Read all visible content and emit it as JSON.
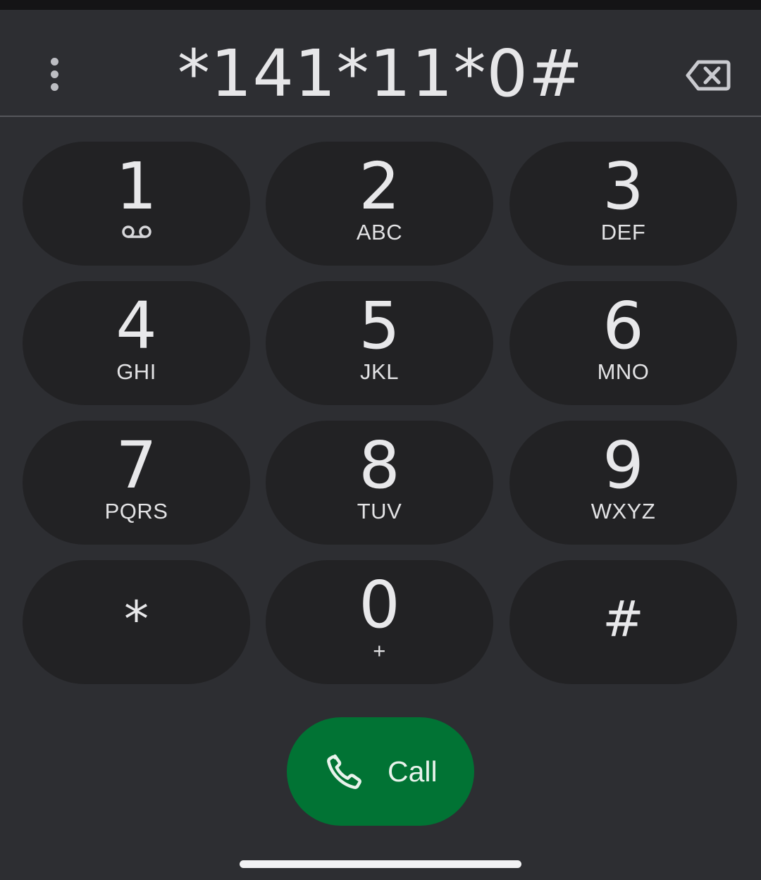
{
  "dialer": {
    "dialed_number": "*141*11*0#",
    "more_options_icon": "more-vert-icon",
    "backspace_icon": "backspace-icon"
  },
  "keypad": {
    "keys": [
      {
        "digit": "1",
        "letters": "",
        "icon": "voicemail-icon"
      },
      {
        "digit": "2",
        "letters": "ABC"
      },
      {
        "digit": "3",
        "letters": "DEF"
      },
      {
        "digit": "4",
        "letters": "GHI"
      },
      {
        "digit": "5",
        "letters": "JKL"
      },
      {
        "digit": "6",
        "letters": "MNO"
      },
      {
        "digit": "7",
        "letters": "PQRS"
      },
      {
        "digit": "8",
        "letters": "TUV"
      },
      {
        "digit": "9",
        "letters": "WXYZ"
      },
      {
        "digit": "*",
        "letters": ""
      },
      {
        "digit": "0",
        "letters": "+"
      },
      {
        "digit": "#",
        "letters": ""
      }
    ]
  },
  "call_button": {
    "label": "Call",
    "icon": "phone-icon",
    "color": "#017334"
  },
  "colors": {
    "background": "#2d2e32",
    "key_background": "#222224",
    "text": "#e6e6e8"
  }
}
